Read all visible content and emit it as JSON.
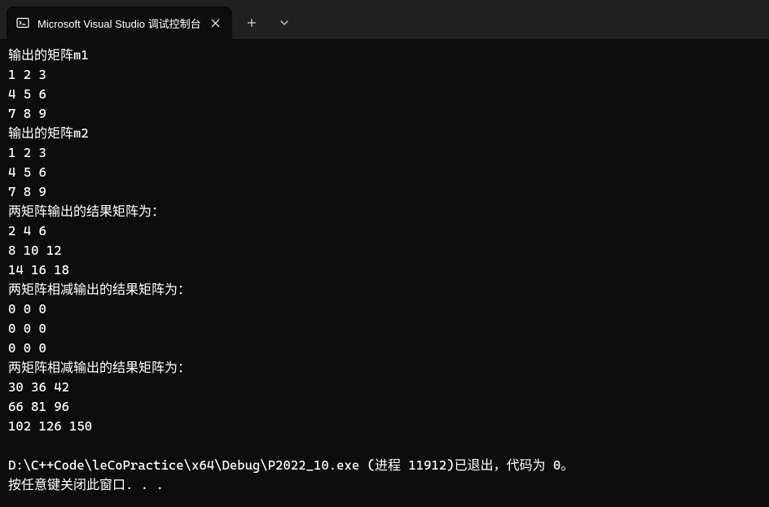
{
  "tab": {
    "title": "Microsoft Visual Studio 调试控制台"
  },
  "output": {
    "lines": [
      "输出的矩阵m1",
      "1 2 3",
      "4 5 6",
      "7 8 9",
      "输出的矩阵m2",
      "1 2 3",
      "4 5 6",
      "7 8 9",
      "两矩阵输出的结果矩阵为：",
      "2 4 6",
      "8 10 12",
      "14 16 18",
      "两矩阵相减输出的结果矩阵为：",
      "0 0 0",
      "0 0 0",
      "0 0 0",
      "两矩阵相减输出的结果矩阵为：",
      "30 36 42",
      "66 81 96",
      "102 126 150"
    ],
    "exit_line": "D:\\C++Code\\leCoPractice\\x64\\Debug\\P2022_10.exe (进程 11912)已退出，代码为 0。",
    "prompt_line": "按任意键关闭此窗口. . ."
  }
}
